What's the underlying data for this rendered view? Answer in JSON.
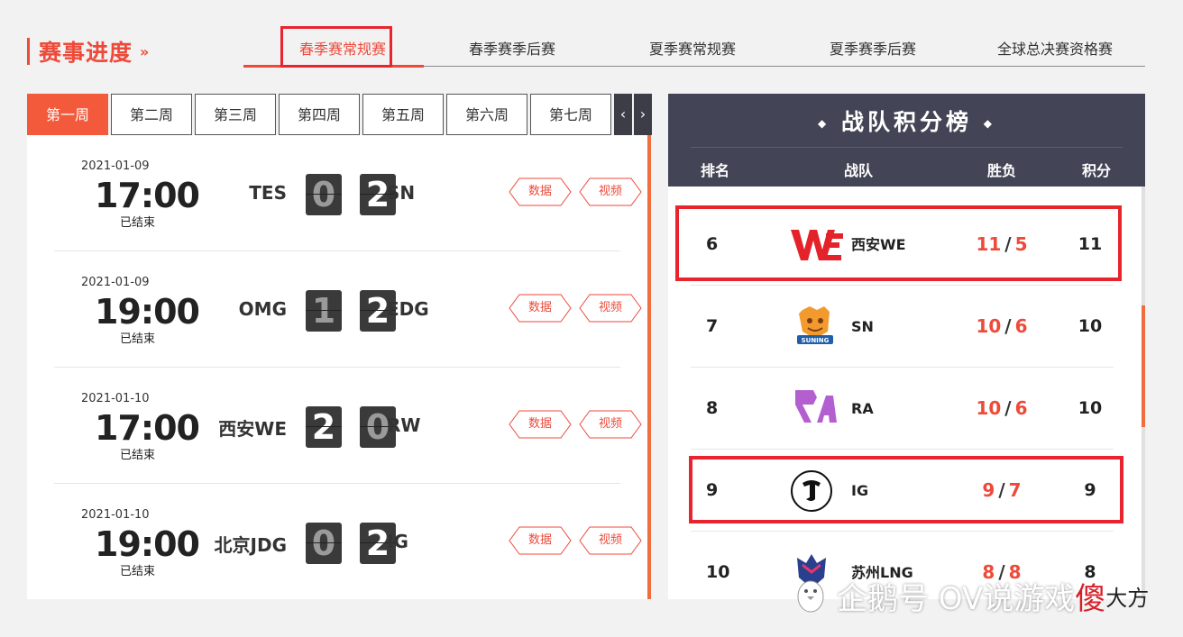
{
  "section": {
    "title": "赛事进度",
    "arrow": "»"
  },
  "stage_tabs": [
    "春季赛常规赛",
    "春季赛季后赛",
    "夏季赛常规赛",
    "夏季赛季后赛",
    "全球总决赛资格赛"
  ],
  "active_stage_index": 0,
  "weeks": [
    "第一周",
    "第二周",
    "第三周",
    "第四周",
    "第五周",
    "第六周",
    "第七周"
  ],
  "active_week_index": 0,
  "week_nav": {
    "prev": "‹",
    "next": "›"
  },
  "buttons": {
    "stats": "数据",
    "video": "视频"
  },
  "matches": [
    {
      "date": "2021-01-09",
      "time": "17:00",
      "status": "已结束",
      "team_left": "TES",
      "score_left": "0",
      "score_right": "2",
      "team_right": "SN"
    },
    {
      "date": "2021-01-09",
      "time": "19:00",
      "status": "已结束",
      "team_left": "OMG",
      "score_left": "1",
      "score_right": "2",
      "team_right": "EDG"
    },
    {
      "date": "2021-01-10",
      "time": "17:00",
      "status": "已结束",
      "team_left": "西安WE",
      "score_left": "2",
      "score_right": "0",
      "team_right": "RW"
    },
    {
      "date": "2021-01-10",
      "time": "19:00",
      "status": "已结束",
      "team_left": "北京JDG",
      "score_left": "0",
      "score_right": "2",
      "team_right": "IG"
    }
  ],
  "standings": {
    "title": "战队积分榜",
    "title_deco": "◆",
    "columns": {
      "rank": "排名",
      "team": "战队",
      "wl": "胜负",
      "points": "积分"
    },
    "rows": [
      {
        "rank": "6",
        "team": "西安WE",
        "wins": "11",
        "losses": "5",
        "points": "11",
        "logo": "we-logo"
      },
      {
        "rank": "7",
        "team": "SN",
        "wins": "10",
        "losses": "6",
        "points": "10",
        "logo": "sn-logo",
        "logo_text": "SUNING"
      },
      {
        "rank": "8",
        "team": "RA",
        "wins": "10",
        "losses": "6",
        "points": "10",
        "logo": "ra-logo"
      },
      {
        "rank": "9",
        "team": "IG",
        "wins": "9",
        "losses": "7",
        "points": "9",
        "logo": "ig-logo"
      },
      {
        "rank": "10",
        "team": "苏州LNG",
        "wins": "8",
        "losses": "8",
        "points": "8",
        "logo": "lng-logo"
      }
    ]
  },
  "watermark": {
    "text": "企鹅号 OV说游戏",
    "suffix_red": "傻",
    "suffix": "大方"
  },
  "colors": {
    "accent": "#ee4a3a",
    "dark_header": "#434455",
    "highlight": "#e8242f"
  }
}
